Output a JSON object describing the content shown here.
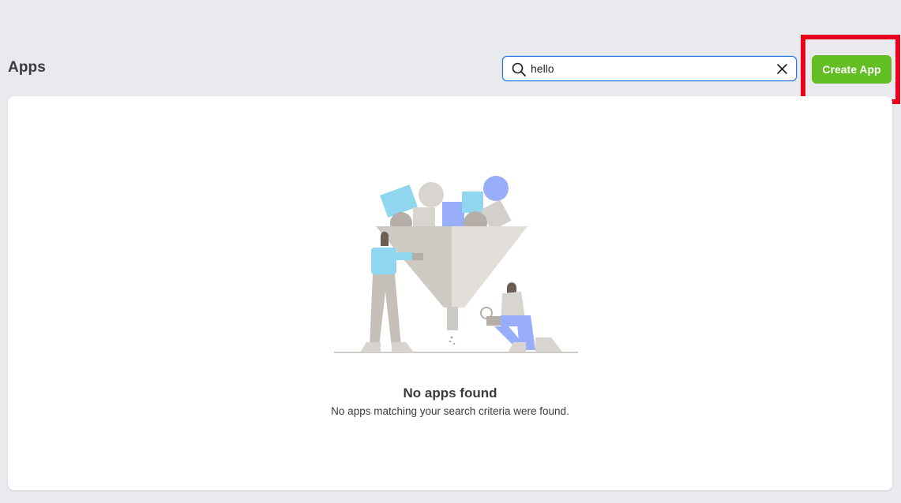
{
  "header": {
    "title": "Apps"
  },
  "search": {
    "value": "hello",
    "icon": "search-icon",
    "clear_icon": "close-icon"
  },
  "toolbar": {
    "create_label": "Create App"
  },
  "empty_state": {
    "title": "No apps found",
    "message": "No apps matching your search criteria were found.",
    "illustration": "funnel-illustration"
  },
  "colors": {
    "accent_blue": "#1b74e4",
    "create_button_green": "#63be23",
    "highlight_red": "#e8001c",
    "page_background": "#e9eaee"
  }
}
